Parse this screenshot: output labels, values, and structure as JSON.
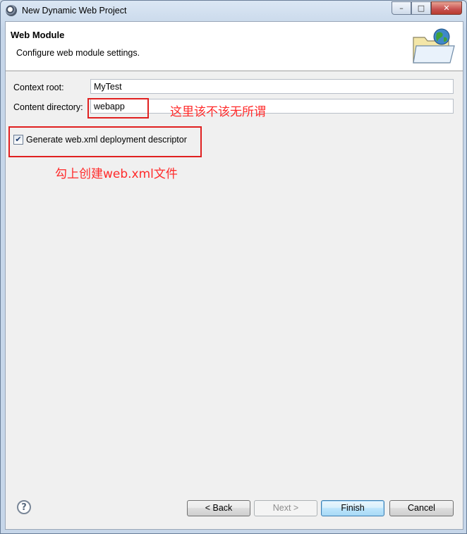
{
  "window": {
    "title": "New Dynamic Web Project",
    "controls": [
      "minimize-icon",
      "maximize-icon",
      "close-icon"
    ]
  },
  "banner": {
    "title": "Web Module",
    "description": "Configure web module settings.",
    "icon": "web-folder-globe-icon"
  },
  "form": {
    "context_root_label": "Context root:",
    "context_root_value": "MyTest",
    "content_dir_label": "Content directory:",
    "content_dir_value": "webapp",
    "generate_xml_label": "Generate web.xml deployment descriptor",
    "generate_xml_checked": true
  },
  "annotations": {
    "content_dir_note": "这里该不该无所谓",
    "checkbox_note": "勾上创建web.xml文件",
    "color": "#ff2a2a"
  },
  "buttons": {
    "help": "?",
    "back": "< Back",
    "next": "Next >",
    "finish": "Finish",
    "cancel": "Cancel"
  }
}
